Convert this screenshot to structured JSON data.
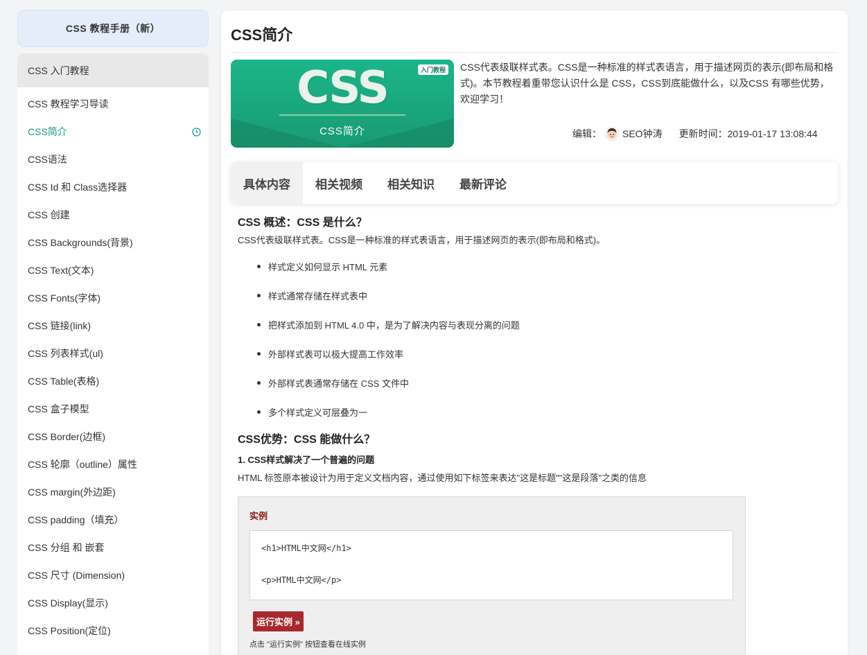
{
  "sidebar": {
    "header": "CSS 教程手册（新）",
    "section": "CSS 入门教程",
    "items": [
      {
        "label": "CSS 教程学习导读"
      },
      {
        "label": "CSS简介"
      },
      {
        "label": "CSS语法"
      },
      {
        "label": "CSS Id 和 Class选择器"
      },
      {
        "label": "CSS 创建"
      },
      {
        "label": "CSS Backgrounds(背景)"
      },
      {
        "label": "CSS Text(文本)"
      },
      {
        "label": "CSS Fonts(字体)"
      },
      {
        "label": "CSS 链接(link)"
      },
      {
        "label": "CSS 列表样式(ul)"
      },
      {
        "label": "CSS Table(表格)"
      },
      {
        "label": "CSS 盒子模型"
      },
      {
        "label": "CSS Border(边框)"
      },
      {
        "label": "CSS 轮廓（outline）属性"
      },
      {
        "label": "CSS margin(外边距)"
      },
      {
        "label": "CSS padding（填充）"
      },
      {
        "label": "CSS 分组 和 嵌套"
      },
      {
        "label": "CSS 尺寸 (Dimension)"
      },
      {
        "label": "CSS Display(显示)"
      },
      {
        "label": "CSS Position(定位)"
      }
    ],
    "active_index": 1,
    "active_icon": "clock-icon"
  },
  "main": {
    "title": "CSS简介",
    "banner": {
      "badge": "入门教程",
      "big_text": "CSS",
      "subtitle": "CSS简介"
    },
    "intro": "CSS代表级联样式表。CSS是一种标准的样式表语言，用于描述网页的表示(即布局和格式)。本节教程着重带您认识什么是 CSS，CSS到底能做什么，以及CSS 有哪些优势，欢迎学习！",
    "meta": {
      "editor_label": "编辑：",
      "editor_name": "SEO钟涛",
      "update_label": "更新时间：",
      "update_time": "2019-01-17 13:08:44"
    },
    "tabs": [
      {
        "label": "具体内容"
      },
      {
        "label": "相关视频"
      },
      {
        "label": "相关知识"
      },
      {
        "label": "最新评论"
      }
    ],
    "content": {
      "h2_overview": "CSS 概述：CSS 是什么？",
      "overview_para": "CSS代表级联样式表。CSS是一种标准的样式表语言，用于描述网页的表示(即布局和格式)。",
      "bullets": [
        "样式定义如何显示 HTML 元素",
        "样式通常存储在样式表中",
        "把样式添加到 HTML 4.0 中，是为了解决内容与表现分离的问题",
        "外部样式表可以极大提高工作效率",
        "外部样式表通常存储在 CSS 文件中",
        "多个样式定义可层叠为一"
      ],
      "h2_advantages": "CSS优势：CSS 能做什么？",
      "h3_point1": "1. CSS样式解决了一个普遍的问题",
      "point1_para": "HTML 标签原本被设计为用于定义文档内容，通过使用如下标签来表达\"这是标题\"\"这是段落\"之类的信息"
    },
    "example": {
      "label": "实例",
      "code_lines": [
        "<h1>HTML中文网</h1>",
        "<p>HTML中文网</p>"
      ],
      "run_button": "运行实例 »",
      "hint": "点击 \"运行实例\" 按钮查看在线实例"
    }
  },
  "colors": {
    "accent": "#1a9a8a",
    "run_button": "#a7292c",
    "example_label": "#8b1a1a",
    "sidebar_header_bg": "#e5ecfa"
  }
}
